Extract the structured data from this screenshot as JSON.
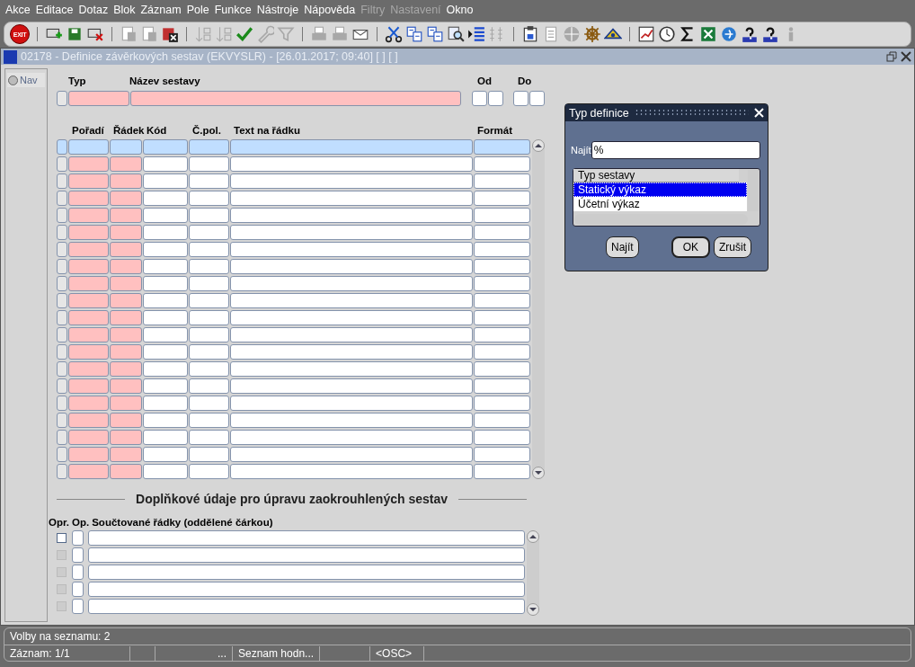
{
  "menu": [
    {
      "label": "Akce",
      "disabled": false
    },
    {
      "label": "Editace",
      "disabled": false
    },
    {
      "label": "Dotaz",
      "disabled": false
    },
    {
      "label": "Blok",
      "disabled": false
    },
    {
      "label": "Záznam",
      "disabled": false
    },
    {
      "label": "Pole",
      "disabled": false
    },
    {
      "label": "Funkce",
      "disabled": false
    },
    {
      "label": "Nástroje",
      "disabled": false
    },
    {
      "label": "Nápověda",
      "disabled": false
    },
    {
      "label": "Filtry",
      "disabled": true
    },
    {
      "label": "Nastavení",
      "disabled": true
    },
    {
      "label": "Okno",
      "disabled": false
    }
  ],
  "toolbar": {
    "exit_label": "EXIT",
    "groups": [
      [
        {
          "disabled": false
        }
      ],
      [
        {
          "disabled": false
        },
        {
          "disabled": false
        },
        {
          "disabled": false
        }
      ],
      [
        {
          "disabled": true
        },
        {
          "disabled": true
        },
        {
          "disabled": false
        }
      ],
      [
        {
          "disabled": true
        },
        {
          "disabled": true
        },
        {
          "disabled": false
        },
        {
          "disabled": true
        },
        {
          "disabled": true
        }
      ],
      [
        {
          "disabled": true
        },
        {
          "disabled": true
        },
        {
          "disabled": false
        }
      ],
      [
        {
          "disabled": false
        },
        {
          "disabled": false
        },
        {
          "disabled": false
        },
        {
          "disabled": false
        },
        {
          "disabled": false
        },
        {
          "disabled": true
        }
      ],
      [
        {
          "disabled": false
        },
        {
          "disabled": true
        },
        {
          "disabled": true
        },
        {
          "disabled": false
        },
        {
          "disabled": false
        }
      ],
      [
        {
          "disabled": false
        },
        {
          "disabled": false
        },
        {
          "disabled": false
        },
        {
          "disabled": false
        },
        {
          "disabled": false
        },
        {
          "disabled": false
        },
        {
          "disabled": false
        },
        {
          "disabled": true
        }
      ]
    ]
  },
  "form_window": {
    "title": "02178 - Definice závěrkových sestav (EKVYSLR) - [26.01.2017; 09:40]  [ ]  [ ]"
  },
  "nav": {
    "label": "Nav",
    "selected": false
  },
  "header": {
    "columns": [
      "Typ",
      "Název sestavy",
      "Od",
      "Do"
    ]
  },
  "table": {
    "columns": [
      "Pořadí",
      "Řádek",
      "Kód",
      "Č.pol.",
      "Text na řádku",
      "Formát"
    ],
    "rows": [
      {
        "selected": true
      },
      {
        "selected": false
      },
      {
        "selected": false
      },
      {
        "selected": false
      },
      {
        "selected": false
      },
      {
        "selected": false
      },
      {
        "selected": false
      },
      {
        "selected": false
      },
      {
        "selected": false
      },
      {
        "selected": false
      },
      {
        "selected": false
      },
      {
        "selected": false
      },
      {
        "selected": false
      },
      {
        "selected": false
      },
      {
        "selected": false
      },
      {
        "selected": false
      },
      {
        "selected": false
      },
      {
        "selected": false
      },
      {
        "selected": false
      },
      {
        "selected": false
      }
    ]
  },
  "section": {
    "title": "Doplňkové údaje pro úpravu zaokrouhlených sestav"
  },
  "sums": {
    "columns": [
      "Opr.",
      "Op.",
      "Součtované řádky (oddělené čárkou)"
    ],
    "rows": [
      {
        "disabled": false
      },
      {
        "disabled": true
      },
      {
        "disabled": true
      },
      {
        "disabled": true
      },
      {
        "disabled": true
      }
    ]
  },
  "dialog": {
    "title": "Typ definice",
    "find_label": "Najít",
    "find_value": "%",
    "list_header": "Typ sestavy",
    "items": [
      {
        "label": "Statický výkaz",
        "selected": true
      },
      {
        "label": "Účetní výkaz",
        "selected": false
      }
    ],
    "buttons": [
      {
        "label": "Najít",
        "default": false
      },
      {
        "label": "OK",
        "default": true
      },
      {
        "label": "Zrušit",
        "default": false
      }
    ]
  },
  "status_bar": {
    "message": "Volby na seznamu: 2",
    "fields": [
      {
        "text": "Záznam: 1/1"
      },
      {
        "text": "..."
      },
      {
        "text": "Seznam hodn..."
      },
      {
        "text": "<OSC>"
      }
    ]
  }
}
